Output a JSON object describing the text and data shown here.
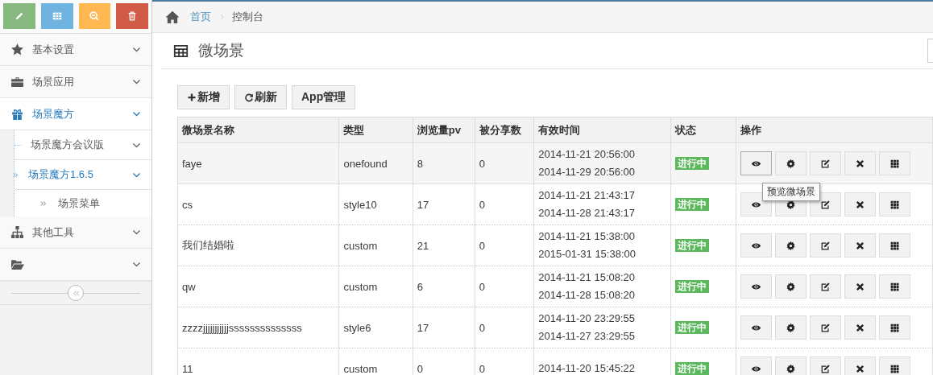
{
  "breadcrumb": [
    {
      "label": "首页",
      "link": true
    },
    {
      "label": "控制台",
      "link": false
    }
  ],
  "sidebar": {
    "items": [
      {
        "label": "基本设置",
        "selected": false
      },
      {
        "label": "场景应用",
        "selected": false
      },
      {
        "label": "场景魔方",
        "selected": true,
        "children": [
          {
            "label": "场景魔方会议版",
            "selected": false
          },
          {
            "label": "场景魔方1.6.5",
            "selected": true,
            "children": [
              {
                "label": "场景菜单",
                "selected": false
              }
            ]
          }
        ]
      },
      {
        "label": "其他工具",
        "selected": false
      },
      {
        "selected": false
      }
    ]
  },
  "page": {
    "title": "微场景"
  },
  "toolbar": [
    {
      "kind": "add",
      "label": "新增"
    },
    {
      "kind": "refresh",
      "label": "刷新"
    },
    {
      "kind": "plain",
      "label": "App管理"
    }
  ],
  "table": {
    "columns": [
      "微场景名称",
      "类型",
      "浏览量pv",
      "被分享数",
      "有效时间",
      "状态",
      "操作"
    ],
    "rows": [
      {
        "name": "faye",
        "type": "onefound",
        "pv": "8",
        "shares": "0",
        "start": "2014-11-21 20:56:00",
        "end": "2014-11-29 20:56:00",
        "status": "进行中",
        "hovered": true
      },
      {
        "name": "cs",
        "type": "style10",
        "pv": "17",
        "shares": "0",
        "start": "2014-11-21 21:43:17",
        "end": "2014-11-28 21:43:17",
        "status": "进行中",
        "hovered": false
      },
      {
        "name": "我们结婚啦",
        "type": "custom",
        "pv": "21",
        "shares": "0",
        "start": "2014-11-21 15:38:00",
        "end": "2015-01-31 15:38:00",
        "status": "进行中",
        "hovered": false
      },
      {
        "name": "qw",
        "type": "custom",
        "pv": "6",
        "shares": "0",
        "start": "2014-11-21 15:08:20",
        "end": "2014-11-28 15:08:20",
        "status": "进行中",
        "hovered": false
      },
      {
        "name": "zzzzjjjjjjjjjjjssssssssssssss",
        "type": "style6",
        "pv": "17",
        "shares": "0",
        "start": "2014-11-20 23:29:55",
        "end": "2014-11-27 23:29:55",
        "status": "进行中",
        "hovered": false
      },
      {
        "name": "11",
        "type": "custom",
        "pv": "0",
        "shares": "0",
        "start": "2014-11-20 15:45:22",
        "status": "进行中",
        "hovered": false
      }
    ]
  },
  "tooltip": {
    "text": "预览微场景"
  }
}
